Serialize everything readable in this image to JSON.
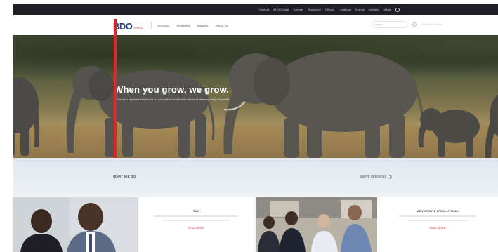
{
  "utility_bar": {
    "links": [
      "Contact",
      "BDO Global",
      "Careers",
      "Subscribe",
      "Offices",
      "Locations",
      "Events",
      "Insights",
      "Media"
    ]
  },
  "nav": {
    "logo": "BDO",
    "logo_sub": "AFRICA",
    "items": [
      "Services",
      "Industries",
      "Insights",
      "About Us"
    ],
    "search_placeholder": "Search",
    "cta": "Contact BDO Africa"
  },
  "hero": {
    "headline": "When you grow, we grow.",
    "subtext": "A focus on key business issues for your clients and trusted advisors at every stage of growth."
  },
  "section": {
    "title": "WHAT WE DO",
    "more": "MORE SERVICES"
  },
  "cards": [
    {
      "title": "TAX",
      "link": "READ MORE"
    },
    {
      "title": "ADVISORY & IT SOLUTIONS",
      "link": "READ MORE"
    }
  ],
  "colors": {
    "brand_red": "#e3242b",
    "brand_blue": "#2a3f7a",
    "utility_bar": "#1d1f24"
  }
}
